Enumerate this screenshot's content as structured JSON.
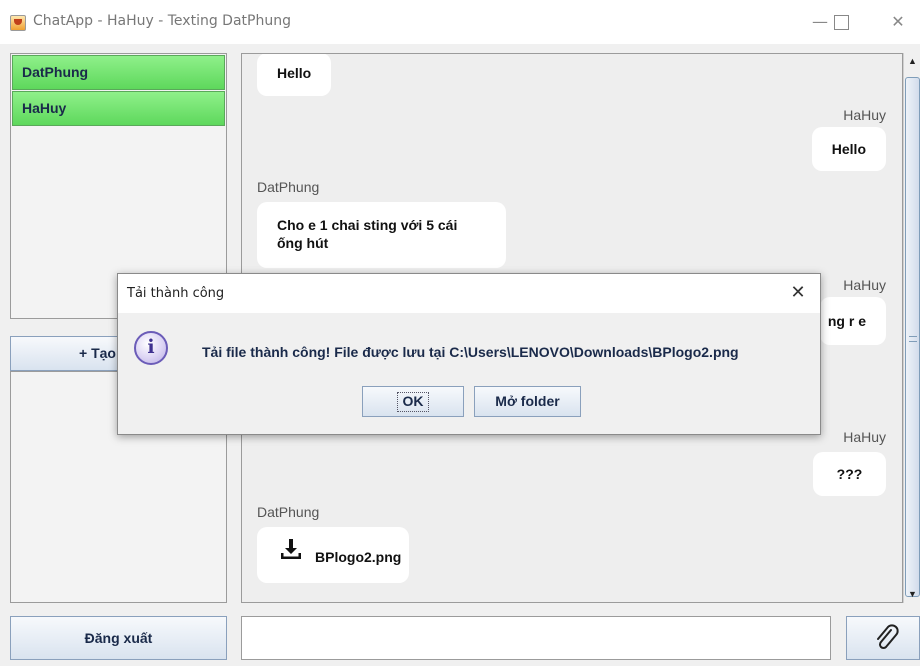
{
  "window": {
    "title": "ChatApp - HaHuy - Texting DatPhung",
    "icon": "java-cup-icon",
    "minimize": "—",
    "close": "✕"
  },
  "sidebar": {
    "contacts": [
      "DatPhung",
      "HaHuy"
    ],
    "create_group_label": "+ Tạo nhóm"
  },
  "chat": {
    "messages": [
      {
        "text": "Hello"
      },
      {
        "sender": "HaHuy",
        "text": "Hello"
      },
      {
        "sender": "DatPhung",
        "text_line1": "Cho e 1 chai sting với 5 cái",
        "text_line2": "ống hút"
      },
      {
        "sender": "HaHuy",
        "text": "ng r e"
      },
      {
        "sender": "HaHuy",
        "text": "???"
      },
      {
        "sender": "DatPhung",
        "file_name": "BPlogo2.png",
        "icon": "download-icon"
      }
    ]
  },
  "footer": {
    "logout_label": "Đăng xuất",
    "message_value": "",
    "attach_icon": "paperclip-icon"
  },
  "dialog": {
    "title": "Tải thành công",
    "close": "✕",
    "icon_glyph": "i",
    "message": "Tải file thành công! File được lưu tại C:\\Users\\LENOVO\\Downloads\\BPlogo2.png",
    "ok_label": "OK",
    "open_folder_label": "Mở folder"
  },
  "colors": {
    "contact_active": "#6fe06c",
    "button_gradient_top": "#f7f9fc",
    "button_gradient_bottom": "#d9e3ef",
    "bubble": "#ffffff",
    "chat_background": "#eeeeee"
  }
}
